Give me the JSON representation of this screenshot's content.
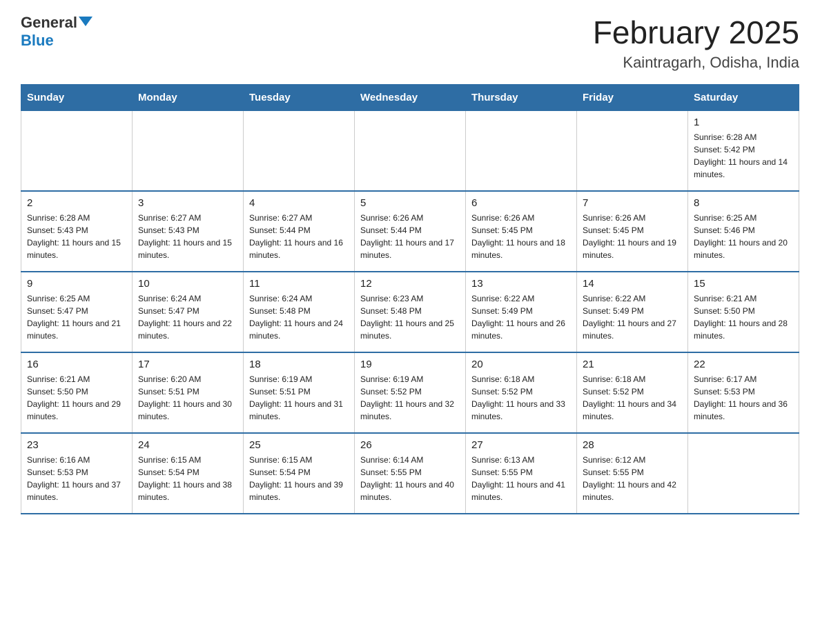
{
  "header": {
    "logo_general": "General",
    "logo_blue": "Blue",
    "month_title": "February 2025",
    "location": "Kaintragarh, Odisha, India"
  },
  "days_of_week": [
    "Sunday",
    "Monday",
    "Tuesday",
    "Wednesday",
    "Thursday",
    "Friday",
    "Saturday"
  ],
  "weeks": [
    [
      {
        "day": "",
        "info": ""
      },
      {
        "day": "",
        "info": ""
      },
      {
        "day": "",
        "info": ""
      },
      {
        "day": "",
        "info": ""
      },
      {
        "day": "",
        "info": ""
      },
      {
        "day": "",
        "info": ""
      },
      {
        "day": "1",
        "info": "Sunrise: 6:28 AM\nSunset: 5:42 PM\nDaylight: 11 hours and 14 minutes."
      }
    ],
    [
      {
        "day": "2",
        "info": "Sunrise: 6:28 AM\nSunset: 5:43 PM\nDaylight: 11 hours and 15 minutes."
      },
      {
        "day": "3",
        "info": "Sunrise: 6:27 AM\nSunset: 5:43 PM\nDaylight: 11 hours and 15 minutes."
      },
      {
        "day": "4",
        "info": "Sunrise: 6:27 AM\nSunset: 5:44 PM\nDaylight: 11 hours and 16 minutes."
      },
      {
        "day": "5",
        "info": "Sunrise: 6:26 AM\nSunset: 5:44 PM\nDaylight: 11 hours and 17 minutes."
      },
      {
        "day": "6",
        "info": "Sunrise: 6:26 AM\nSunset: 5:45 PM\nDaylight: 11 hours and 18 minutes."
      },
      {
        "day": "7",
        "info": "Sunrise: 6:26 AM\nSunset: 5:45 PM\nDaylight: 11 hours and 19 minutes."
      },
      {
        "day": "8",
        "info": "Sunrise: 6:25 AM\nSunset: 5:46 PM\nDaylight: 11 hours and 20 minutes."
      }
    ],
    [
      {
        "day": "9",
        "info": "Sunrise: 6:25 AM\nSunset: 5:47 PM\nDaylight: 11 hours and 21 minutes."
      },
      {
        "day": "10",
        "info": "Sunrise: 6:24 AM\nSunset: 5:47 PM\nDaylight: 11 hours and 22 minutes."
      },
      {
        "day": "11",
        "info": "Sunrise: 6:24 AM\nSunset: 5:48 PM\nDaylight: 11 hours and 24 minutes."
      },
      {
        "day": "12",
        "info": "Sunrise: 6:23 AM\nSunset: 5:48 PM\nDaylight: 11 hours and 25 minutes."
      },
      {
        "day": "13",
        "info": "Sunrise: 6:22 AM\nSunset: 5:49 PM\nDaylight: 11 hours and 26 minutes."
      },
      {
        "day": "14",
        "info": "Sunrise: 6:22 AM\nSunset: 5:49 PM\nDaylight: 11 hours and 27 minutes."
      },
      {
        "day": "15",
        "info": "Sunrise: 6:21 AM\nSunset: 5:50 PM\nDaylight: 11 hours and 28 minutes."
      }
    ],
    [
      {
        "day": "16",
        "info": "Sunrise: 6:21 AM\nSunset: 5:50 PM\nDaylight: 11 hours and 29 minutes."
      },
      {
        "day": "17",
        "info": "Sunrise: 6:20 AM\nSunset: 5:51 PM\nDaylight: 11 hours and 30 minutes."
      },
      {
        "day": "18",
        "info": "Sunrise: 6:19 AM\nSunset: 5:51 PM\nDaylight: 11 hours and 31 minutes."
      },
      {
        "day": "19",
        "info": "Sunrise: 6:19 AM\nSunset: 5:52 PM\nDaylight: 11 hours and 32 minutes."
      },
      {
        "day": "20",
        "info": "Sunrise: 6:18 AM\nSunset: 5:52 PM\nDaylight: 11 hours and 33 minutes."
      },
      {
        "day": "21",
        "info": "Sunrise: 6:18 AM\nSunset: 5:52 PM\nDaylight: 11 hours and 34 minutes."
      },
      {
        "day": "22",
        "info": "Sunrise: 6:17 AM\nSunset: 5:53 PM\nDaylight: 11 hours and 36 minutes."
      }
    ],
    [
      {
        "day": "23",
        "info": "Sunrise: 6:16 AM\nSunset: 5:53 PM\nDaylight: 11 hours and 37 minutes."
      },
      {
        "day": "24",
        "info": "Sunrise: 6:15 AM\nSunset: 5:54 PM\nDaylight: 11 hours and 38 minutes."
      },
      {
        "day": "25",
        "info": "Sunrise: 6:15 AM\nSunset: 5:54 PM\nDaylight: 11 hours and 39 minutes."
      },
      {
        "day": "26",
        "info": "Sunrise: 6:14 AM\nSunset: 5:55 PM\nDaylight: 11 hours and 40 minutes."
      },
      {
        "day": "27",
        "info": "Sunrise: 6:13 AM\nSunset: 5:55 PM\nDaylight: 11 hours and 41 minutes."
      },
      {
        "day": "28",
        "info": "Sunrise: 6:12 AM\nSunset: 5:55 PM\nDaylight: 11 hours and 42 minutes."
      },
      {
        "day": "",
        "info": ""
      }
    ]
  ]
}
